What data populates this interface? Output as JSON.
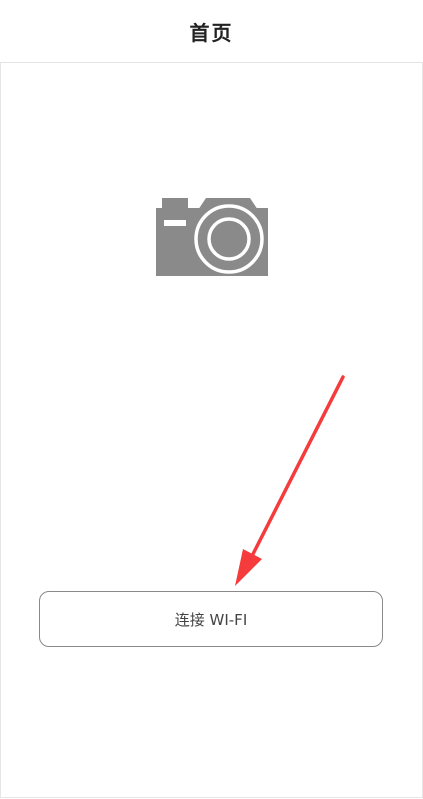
{
  "header": {
    "title": "首页"
  },
  "main": {
    "camera_icon": "camera-icon",
    "connect_button_label": "连接 WI-FI"
  },
  "annotation": {
    "arrow_color": "#f53b3b"
  },
  "colors": {
    "icon": "#8a8a8a",
    "button_border": "#8a8a8a",
    "background": "#ffffff"
  }
}
